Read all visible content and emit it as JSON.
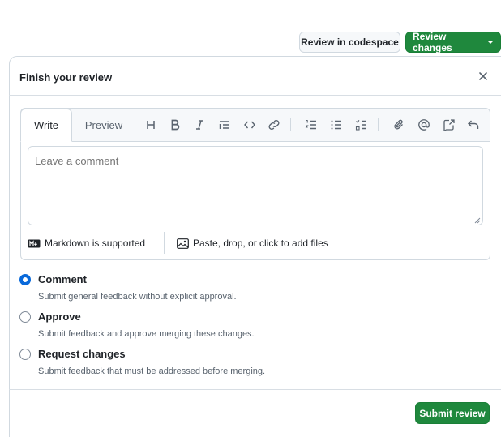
{
  "header": {
    "codespace_label": "Review in codespace",
    "review_changes_label": "Review changes"
  },
  "panel": {
    "title": "Finish your review"
  },
  "editor": {
    "tabs": [
      {
        "label": "Write",
        "active": true
      },
      {
        "label": "Preview",
        "active": false
      }
    ],
    "toolbar": [
      "heading-icon",
      "bold-icon",
      "italic-icon",
      "quote-icon",
      "code-icon",
      "link-icon",
      "ordered-list-icon",
      "unordered-list-icon",
      "task-list-icon",
      "attach-icon",
      "mention-icon",
      "reference-icon",
      "undo-icon"
    ],
    "comment_placeholder": "Leave a comment",
    "markdown_note": "Markdown is supported",
    "attach_note": "Paste, drop, or click to add files"
  },
  "options": [
    {
      "label": "Comment",
      "description": "Submit general feedback without explicit approval.",
      "checked": true
    },
    {
      "label": "Approve",
      "description": "Submit feedback and approve merging these changes.",
      "checked": false
    },
    {
      "label": "Request changes",
      "description": "Submit feedback that must be addressed before merging.",
      "checked": false
    }
  ],
  "footer": {
    "submit_label": "Submit review"
  },
  "colors": {
    "primary_green": "#1f883d",
    "accent_blue": "#0969da",
    "muted_text": "#59636e",
    "border": "#d1d9e0"
  }
}
